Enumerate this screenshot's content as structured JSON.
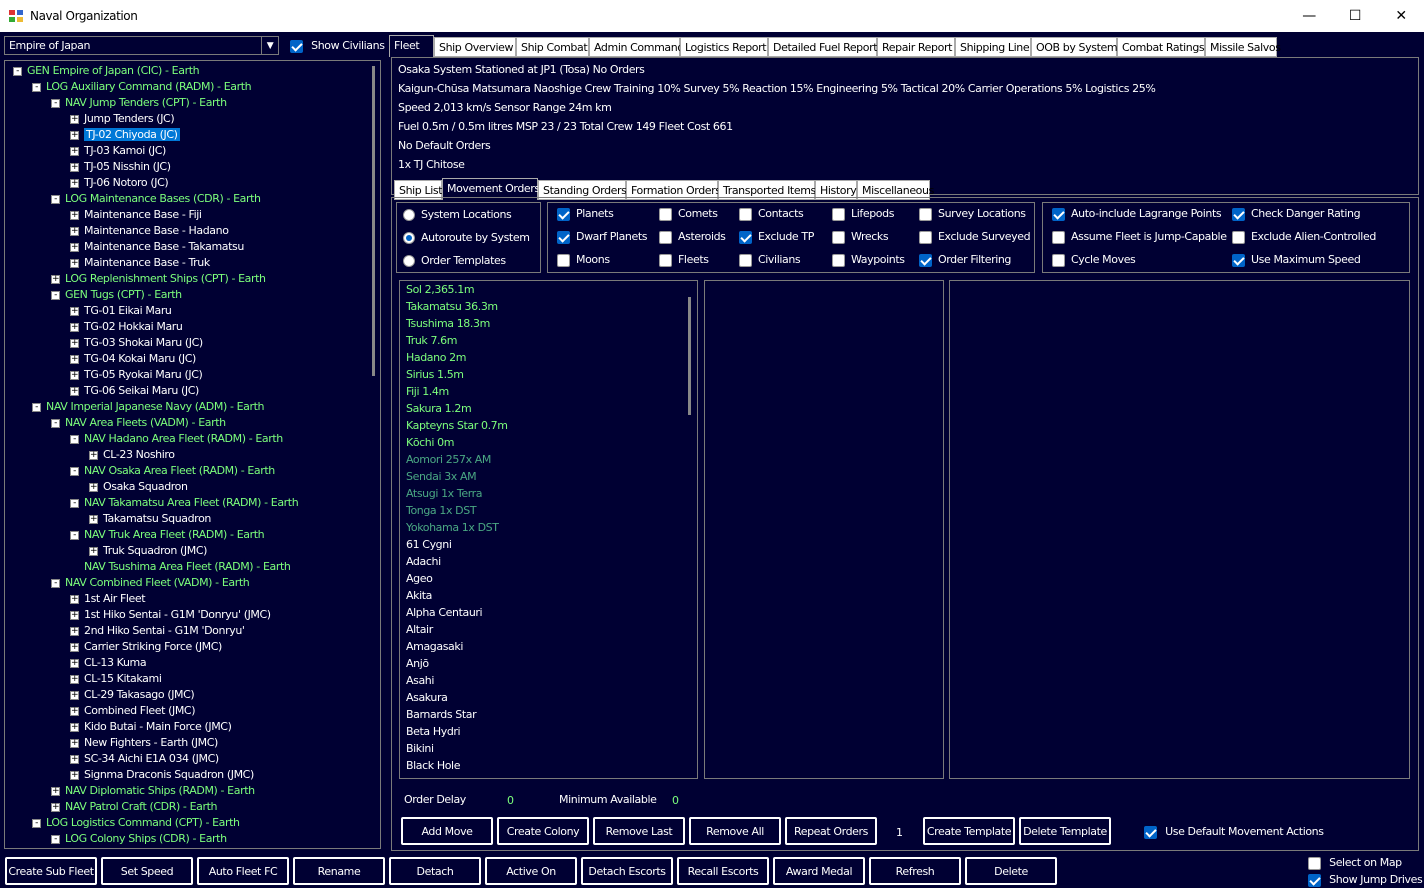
{
  "window": {
    "title": "Naval Organization",
    "minimize": "—",
    "maximize": "☐",
    "close": "✕"
  },
  "race_select": {
    "value": "Empire of Japan"
  },
  "show_civilians": {
    "label": "Show Civilians",
    "checked": true
  },
  "tree": [
    {
      "text": "GEN Empire of Japan  (CIC)  -  Earth",
      "level": 0,
      "exp": "−",
      "green": true
    },
    {
      "text": "LOG Auxiliary Command  (RADM)  -  Earth",
      "level": 1,
      "exp": "−",
      "green": true
    },
    {
      "text": "NAV Jump Tenders  (CPT)  -  Earth",
      "level": 2,
      "exp": "−",
      "green": true
    },
    {
      "text": "Jump Tenders  (JC)",
      "level": 3,
      "exp": "+",
      "green": false
    },
    {
      "text": "TJ-02 Chiyoda  (JC)",
      "level": 3,
      "exp": "+",
      "green": false,
      "selected": true
    },
    {
      "text": "TJ-03 Kamoi  (JC)",
      "level": 3,
      "exp": "+",
      "green": false
    },
    {
      "text": "TJ-05 Nisshin  (JC)",
      "level": 3,
      "exp": "+",
      "green": false
    },
    {
      "text": "TJ-06 Notoro  (JC)",
      "level": 3,
      "exp": "+",
      "green": false
    },
    {
      "text": "LOG Maintenance Bases  (CDR)  -  Earth",
      "level": 2,
      "exp": "−",
      "green": true
    },
    {
      "text": "Maintenance Base - Fiji",
      "level": 3,
      "exp": "+",
      "green": false
    },
    {
      "text": "Maintenance Base - Hadano",
      "level": 3,
      "exp": "+",
      "green": false
    },
    {
      "text": "Maintenance Base - Takamatsu",
      "level": 3,
      "exp": "+",
      "green": false
    },
    {
      "text": "Maintenance Base - Truk",
      "level": 3,
      "exp": "+",
      "green": false
    },
    {
      "text": "LOG Replenishment Ships  (CPT)  -  Earth",
      "level": 2,
      "exp": "+",
      "green": true
    },
    {
      "text": "GEN Tugs  (CPT)  -  Earth",
      "level": 2,
      "exp": "−",
      "green": true
    },
    {
      "text": "TG-01 Eikai Maru",
      "level": 3,
      "exp": "+",
      "green": false
    },
    {
      "text": "TG-02 Hokkai Maru",
      "level": 3,
      "exp": "+",
      "green": false
    },
    {
      "text": "TG-03 Shokai Maru  (JC)",
      "level": 3,
      "exp": "+",
      "green": false
    },
    {
      "text": "TG-04 Kokai Maru  (JC)",
      "level": 3,
      "exp": "+",
      "green": false
    },
    {
      "text": "TG-05 Ryokai Maru  (JC)",
      "level": 3,
      "exp": "+",
      "green": false
    },
    {
      "text": "TG-06 Seikai Maru  (JC)",
      "level": 3,
      "exp": "+",
      "green": false
    },
    {
      "text": "NAV Imperial Japanese Navy  (ADM)  -  Earth",
      "level": 1,
      "exp": "−",
      "green": true
    },
    {
      "text": "NAV Area Fleets  (VADM)  -  Earth",
      "level": 2,
      "exp": "−",
      "green": true
    },
    {
      "text": "NAV Hadano Area Fleet  (RADM)  -  Earth",
      "level": 3,
      "exp": "−",
      "green": true
    },
    {
      "text": "CL-23 Noshiro",
      "level": 4,
      "exp": "+",
      "green": false
    },
    {
      "text": "NAV Osaka Area Fleet  (RADM)  -  Earth",
      "level": 3,
      "exp": "−",
      "green": true
    },
    {
      "text": "Osaka Squadron",
      "level": 4,
      "exp": "+",
      "green": false
    },
    {
      "text": "NAV Takamatsu Area Fleet  (RADM)  -  Earth",
      "level": 3,
      "exp": "−",
      "green": true
    },
    {
      "text": "Takamatsu Squadron",
      "level": 4,
      "exp": "+",
      "green": false
    },
    {
      "text": "NAV Truk Area Fleet  (RADM)  -  Earth",
      "level": 3,
      "exp": "−",
      "green": true
    },
    {
      "text": "Truk Squadron  (JMC)",
      "level": 4,
      "exp": "+",
      "green": false
    },
    {
      "text": "NAV Tsushima Area Fleet  (RADM)  -  Earth",
      "level": 3,
      "exp": "",
      "green": true
    },
    {
      "text": "NAV Combined Fleet  (VADM)  -  Earth",
      "level": 2,
      "exp": "−",
      "green": true
    },
    {
      "text": "1st Air Fleet",
      "level": 3,
      "exp": "+",
      "green": false
    },
    {
      "text": "1st Hiko Sentai - G1M 'Donryu'  (JMC)",
      "level": 3,
      "exp": "+",
      "green": false
    },
    {
      "text": "2nd Hiko Sentai - G1M 'Donryu'",
      "level": 3,
      "exp": "+",
      "green": false
    },
    {
      "text": "Carrier Striking Force  (JMC)",
      "level": 3,
      "exp": "+",
      "green": false
    },
    {
      "text": "CL-13 Kuma",
      "level": 3,
      "exp": "+",
      "green": false
    },
    {
      "text": "CL-15 Kitakami",
      "level": 3,
      "exp": "+",
      "green": false
    },
    {
      "text": "CL-29 Takasago  (JMC)",
      "level": 3,
      "exp": "+",
      "green": false
    },
    {
      "text": "Combined Fleet  (JMC)",
      "level": 3,
      "exp": "+",
      "green": false
    },
    {
      "text": "Kido Butai - Main Force  (JMC)",
      "level": 3,
      "exp": "+",
      "green": false
    },
    {
      "text": "New Fighters - Earth  (JMC)",
      "level": 3,
      "exp": "+",
      "green": false
    },
    {
      "text": "SC-34 Aichi E1A 034  (JMC)",
      "level": 3,
      "exp": "+",
      "green": false
    },
    {
      "text": "Signma Draconis Squadron  (JMC)",
      "level": 3,
      "exp": "+",
      "green": false
    },
    {
      "text": "NAV Diplomatic Ships  (RADM)  -  Earth",
      "level": 2,
      "exp": "+",
      "green": true
    },
    {
      "text": "NAV Patrol Craft  (CDR)  -  Earth",
      "level": 2,
      "exp": "+",
      "green": true
    },
    {
      "text": "LOG Logistics Command  (CPT)  -  Earth",
      "level": 1,
      "exp": "−",
      "green": true
    },
    {
      "text": "LOG Colony Ships  (CDR)  -  Earth",
      "level": 2,
      "exp": "−",
      "green": true
    }
  ],
  "main_tabs": [
    "Fleet",
    "Ship Overview",
    "Ship Combat",
    "Admin Command",
    "Logistics Report",
    "Detailed Fuel Report",
    "Repair Report",
    "Shipping Line",
    "OOB by System",
    "Combat Ratings",
    "Missile Salvos"
  ],
  "info_lines": [
    "Osaka System     Stationed at JP1 (Tosa)     No Orders",
    "Kaigun-Chūsa Matsumara Naoshige    Crew Training 10%     Survey 5%     Reaction 15%     Engineering 5%     Tactical 20%     Carrier Operations 5%     Logistics 25%",
    "Speed 2,013 km/s     Sensor Range 24m  km",
    "Fuel 0.5m / 0.5m litres     MSP 23 / 23     Total Crew 149     Fleet Cost 661",
    "No Default Orders",
    "1x TJ Chitose"
  ],
  "sub_tabs": [
    "Ship List",
    "Movement Orders",
    "Standing Orders",
    "Formation Orders",
    "Transported Items",
    "History",
    "Miscellaneous"
  ],
  "radio_options": [
    {
      "label": "System Locations",
      "on": false
    },
    {
      "label": "Autoroute by System",
      "on": true
    },
    {
      "label": "Order Templates",
      "on": false
    }
  ],
  "filters": [
    [
      {
        "label": "Planets",
        "on": true
      },
      {
        "label": "Dwarf Planets",
        "on": true
      },
      {
        "label": "Moons",
        "on": false
      }
    ],
    [
      {
        "label": "Comets",
        "on": false
      },
      {
        "label": "Asteroids",
        "on": false
      },
      {
        "label": "Fleets",
        "on": false
      }
    ],
    [
      {
        "label": "Contacts",
        "on": false
      },
      {
        "label": "Exclude TP",
        "on": true
      },
      {
        "label": "Civilians",
        "on": false
      }
    ],
    [
      {
        "label": "Lifepods",
        "on": false
      },
      {
        "label": "Wrecks",
        "on": false
      },
      {
        "label": "Waypoints",
        "on": false
      }
    ],
    [
      {
        "label": "Survey Locations",
        "on": false
      },
      {
        "label": "Exclude Surveyed",
        "on": false
      },
      {
        "label": "Order Filtering",
        "on": true
      }
    ]
  ],
  "options": [
    [
      {
        "label": "Auto-include Lagrange Points",
        "on": true
      },
      {
        "label": "Assume Fleet is Jump-Capable",
        "on": false
      },
      {
        "label": "Cycle Moves",
        "on": false
      }
    ],
    [
      {
        "label": "Check Danger Rating",
        "on": true
      },
      {
        "label": "Exclude Alien-Controlled",
        "on": false
      },
      {
        "label": "Use Maximum Speed",
        "on": true
      }
    ]
  ],
  "systems": [
    {
      "t": "Sol  2,365.1m",
      "c": "g"
    },
    {
      "t": "Takamatsu  36.3m",
      "c": "g"
    },
    {
      "t": "Tsushima  18.3m",
      "c": "g"
    },
    {
      "t": "Truk  7.6m",
      "c": "g"
    },
    {
      "t": "Hadano  2m",
      "c": "g"
    },
    {
      "t": "Sirius  1.5m",
      "c": "g"
    },
    {
      "t": "Fiji  1.4m",
      "c": "g"
    },
    {
      "t": "Sakura  1.2m",
      "c": "g"
    },
    {
      "t": "Kapteyns Star  0.7m",
      "c": "g"
    },
    {
      "t": "Kōchi  0m",
      "c": "g"
    },
    {
      "t": "Aomori  257x AM",
      "c": "d"
    },
    {
      "t": "Sendai  3x AM",
      "c": "d"
    },
    {
      "t": "Atsugi  1x Terra",
      "c": "d"
    },
    {
      "t": "Tonga  1x DST",
      "c": "d"
    },
    {
      "t": "Yokohama  1x DST",
      "c": "d"
    },
    {
      "t": "61 Cygni",
      "c": "w"
    },
    {
      "t": "Adachi",
      "c": "w"
    },
    {
      "t": "Ageo",
      "c": "w"
    },
    {
      "t": "Akita",
      "c": "w"
    },
    {
      "t": "Alpha Centauri",
      "c": "w"
    },
    {
      "t": "Altair",
      "c": "w"
    },
    {
      "t": "Amagasaki",
      "c": "w"
    },
    {
      "t": "Anjō",
      "c": "w"
    },
    {
      "t": "Asahi",
      "c": "w"
    },
    {
      "t": "Asakura",
      "c": "w"
    },
    {
      "t": "Barnards Star",
      "c": "w"
    },
    {
      "t": "Beta Hydri",
      "c": "w"
    },
    {
      "t": "Bikini",
      "c": "w"
    },
    {
      "t": "Black Hole",
      "c": "w"
    }
  ],
  "order_delay": {
    "label": "Order Delay",
    "value": "0"
  },
  "minimum_available": {
    "label": "Minimum Available",
    "value": "0"
  },
  "order_buttons": [
    "Add Move",
    "Create Colony",
    "Remove Last",
    "Remove All",
    "Repeat Orders"
  ],
  "repeat_count": "1",
  "template_buttons": [
    "Create Template",
    "Delete Template"
  ],
  "use_default": {
    "label": "Use Default Movement Actions",
    "on": true
  },
  "bottom_buttons": [
    "Create Sub Fleet",
    "Set Speed",
    "Auto Fleet FC",
    "Rename",
    "Detach",
    "Active On",
    "Detach Escorts",
    "Recall Escorts",
    "Award Medal",
    "Refresh",
    "Delete"
  ],
  "select_on_map": {
    "label": "Select on Map",
    "on": false
  },
  "show_jump_drives": {
    "label": "Show Jump Drives",
    "on": true
  },
  "colors": {
    "background": "#000033",
    "tree_green": "#7cff7c",
    "dim_green": "#4aa883",
    "selection": "#0078d7",
    "check_blue": "#0064c8"
  }
}
